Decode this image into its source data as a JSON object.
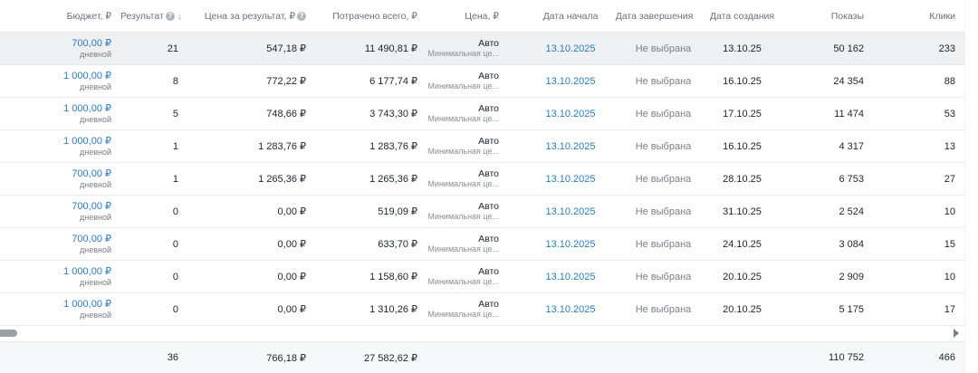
{
  "header": {
    "budget": "Бюджет, ₽",
    "result": "Результат",
    "cost_per_result": "Цена за результат, ₽",
    "spent_total": "Потрачено всего, ₽",
    "price": "Цена, ₽",
    "start_date": "Дата начала",
    "end_date": "Дата завершения",
    "created_date": "Дата создания",
    "impressions": "Показы",
    "clicks": "Клики"
  },
  "icons": {
    "hint": "question-circle-icon",
    "sort": "arrow-down-icon"
  },
  "colors": {
    "link": "#2c7bbf",
    "highlight_row": "#eef0f2"
  },
  "rows": [
    {
      "budget": "700,00 ₽",
      "budget_type": "дневной",
      "result": "21",
      "cost_per_result": "547,18 ₽",
      "spent": "11 490,81 ₽",
      "price": "Авто",
      "price_sub": "Минимальная це...",
      "start": "13.10.2025",
      "end": "Не выбрана",
      "created": "13.10.25",
      "impressions": "50 162",
      "clicks": "233"
    },
    {
      "budget": "1 000,00 ₽",
      "budget_type": "дневной",
      "result": "8",
      "cost_per_result": "772,22 ₽",
      "spent": "6 177,74 ₽",
      "price": "Авто",
      "price_sub": "Минимальная це...",
      "start": "13.10.2025",
      "end": "Не выбрана",
      "created": "16.10.25",
      "impressions": "24 354",
      "clicks": "88"
    },
    {
      "budget": "1 000,00 ₽",
      "budget_type": "дневной",
      "result": "5",
      "cost_per_result": "748,66 ₽",
      "spent": "3 743,30 ₽",
      "price": "Авто",
      "price_sub": "Минимальная це...",
      "start": "13.10.2025",
      "end": "Не выбрана",
      "created": "17.10.25",
      "impressions": "11 474",
      "clicks": "53"
    },
    {
      "budget": "1 000,00 ₽",
      "budget_type": "дневной",
      "result": "1",
      "cost_per_result": "1 283,76 ₽",
      "spent": "1 283,76 ₽",
      "price": "Авто",
      "price_sub": "Минимальная це...",
      "start": "13.10.2025",
      "end": "Не выбрана",
      "created": "16.10.25",
      "impressions": "4 317",
      "clicks": "13"
    },
    {
      "budget": "700,00 ₽",
      "budget_type": "дневной",
      "result": "1",
      "cost_per_result": "1 265,36 ₽",
      "spent": "1 265,36 ₽",
      "price": "Авто",
      "price_sub": "Минимальная це...",
      "start": "13.10.2025",
      "end": "Не выбрана",
      "created": "28.10.25",
      "impressions": "6 753",
      "clicks": "27"
    },
    {
      "budget": "700,00 ₽",
      "budget_type": "дневной",
      "result": "0",
      "cost_per_result": "0,00 ₽",
      "spent": "519,09 ₽",
      "price": "Авто",
      "price_sub": "Минимальная це...",
      "start": "13.10.2025",
      "end": "Не выбрана",
      "created": "31.10.25",
      "impressions": "2 524",
      "clicks": "10"
    },
    {
      "budget": "700,00 ₽",
      "budget_type": "дневной",
      "result": "0",
      "cost_per_result": "0,00 ₽",
      "spent": "633,70 ₽",
      "price": "Авто",
      "price_sub": "Минимальная це...",
      "start": "13.10.2025",
      "end": "Не выбрана",
      "created": "24.10.25",
      "impressions": "3 084",
      "clicks": "15"
    },
    {
      "budget": "1 000,00 ₽",
      "budget_type": "дневной",
      "result": "0",
      "cost_per_result": "0,00 ₽",
      "spent": "1 158,60 ₽",
      "price": "Авто",
      "price_sub": "Минимальная це...",
      "start": "13.10.2025",
      "end": "Не выбрана",
      "created": "20.10.25",
      "impressions": "2 909",
      "clicks": "10"
    },
    {
      "budget": "1 000,00 ₽",
      "budget_type": "дневной",
      "result": "0",
      "cost_per_result": "0,00 ₽",
      "spent": "1 310,26 ₽",
      "price": "Авто",
      "price_sub": "Минимальная це...",
      "start": "13.10.2025",
      "end": "Не выбрана",
      "created": "20.10.25",
      "impressions": "5 175",
      "clicks": "17"
    }
  ],
  "totals": {
    "result": "36",
    "cost_per_result": "766,18 ₽",
    "spent": "27 582,62 ₽",
    "impressions": "110 752",
    "clicks": "466"
  }
}
